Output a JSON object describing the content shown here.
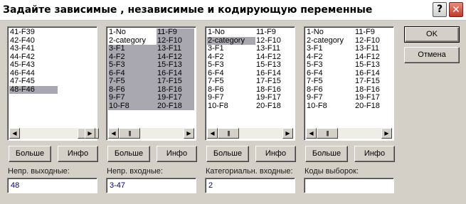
{
  "window": {
    "title": "Задайте зависимые , независимые и кодирующую переменные",
    "help_label": "?",
    "close_label": "✕"
  },
  "lists": [
    {
      "items": [
        {
          "label": "41-F39",
          "selected": false
        },
        {
          "label": "42-F40",
          "selected": false
        },
        {
          "label": "43-F41",
          "selected": false
        },
        {
          "label": "44-F42",
          "selected": false
        },
        {
          "label": "45-F43",
          "selected": false
        },
        {
          "label": "46-F44",
          "selected": false
        },
        {
          "label": "47-F45",
          "selected": false
        },
        {
          "label": "48-F46",
          "selected": true
        }
      ]
    },
    {
      "items": [
        {
          "label": "1-No",
          "selected": false
        },
        {
          "label": "2-category",
          "selected": false
        },
        {
          "label": "3-F1",
          "selected": true
        },
        {
          "label": "4-F2",
          "selected": true
        },
        {
          "label": "5-F3",
          "selected": true
        },
        {
          "label": "6-F4",
          "selected": true
        },
        {
          "label": "7-F5",
          "selected": true
        },
        {
          "label": "8-F6",
          "selected": true
        },
        {
          "label": "9-F7",
          "selected": true
        },
        {
          "label": "10-F8",
          "selected": true
        },
        {
          "label": "11-F9",
          "selected": true
        },
        {
          "label": "12-F10",
          "selected": true
        },
        {
          "label": "13-F11",
          "selected": true
        },
        {
          "label": "14-F12",
          "selected": true
        },
        {
          "label": "15-F13",
          "selected": true
        },
        {
          "label": "16-F14",
          "selected": true
        },
        {
          "label": "17-F15",
          "selected": true
        },
        {
          "label": "18-F16",
          "selected": true
        },
        {
          "label": "19-F17",
          "selected": true
        },
        {
          "label": "20-F18",
          "selected": true
        }
      ]
    },
    {
      "items": [
        {
          "label": "1-No",
          "selected": false
        },
        {
          "label": "2-category",
          "selected": true
        },
        {
          "label": "3-F1",
          "selected": false
        },
        {
          "label": "4-F2",
          "selected": false
        },
        {
          "label": "5-F3",
          "selected": false
        },
        {
          "label": "6-F4",
          "selected": false
        },
        {
          "label": "7-F5",
          "selected": false
        },
        {
          "label": "8-F6",
          "selected": false
        },
        {
          "label": "9-F7",
          "selected": false
        },
        {
          "label": "10-F8",
          "selected": false
        },
        {
          "label": "11-F9",
          "selected": false
        },
        {
          "label": "12-F10",
          "selected": false
        },
        {
          "label": "13-F11",
          "selected": false
        },
        {
          "label": "14-F12",
          "selected": false
        },
        {
          "label": "15-F13",
          "selected": false
        },
        {
          "label": "16-F14",
          "selected": false
        },
        {
          "label": "17-F15",
          "selected": false
        },
        {
          "label": "18-F16",
          "selected": false
        },
        {
          "label": "19-F17",
          "selected": false
        },
        {
          "label": "20-F18",
          "selected": false
        }
      ]
    },
    {
      "items": [
        {
          "label": "1-No",
          "selected": false
        },
        {
          "label": "2-category",
          "selected": false
        },
        {
          "label": "3-F1",
          "selected": false
        },
        {
          "label": "4-F2",
          "selected": false
        },
        {
          "label": "5-F3",
          "selected": false
        },
        {
          "label": "6-F4",
          "selected": false
        },
        {
          "label": "7-F5",
          "selected": false
        },
        {
          "label": "8-F6",
          "selected": false
        },
        {
          "label": "9-F7",
          "selected": false
        },
        {
          "label": "10-F8",
          "selected": false
        },
        {
          "label": "11-F9",
          "selected": false
        },
        {
          "label": "12-F10",
          "selected": false
        },
        {
          "label": "13-F11",
          "selected": false
        },
        {
          "label": "14-F12",
          "selected": false
        },
        {
          "label": "15-F13",
          "selected": false
        },
        {
          "label": "16-F14",
          "selected": false
        },
        {
          "label": "17-F15",
          "selected": false
        },
        {
          "label": "18-F16",
          "selected": false
        },
        {
          "label": "19-F17",
          "selected": false
        },
        {
          "label": "20-F18",
          "selected": false
        }
      ]
    }
  ],
  "buttons": {
    "more_label": "Больше",
    "info_label": "Инфо",
    "ok_label": "OK",
    "cancel_label": "Отмена"
  },
  "fields": [
    {
      "label": "Непр. выходные:",
      "value": "48"
    },
    {
      "label": "Непр. входные:",
      "value": "3-47"
    },
    {
      "label": "Категориальн. входные:",
      "value": "2"
    },
    {
      "label": "Коды выборок:",
      "value": ""
    }
  ],
  "icons": {
    "scroll_left": "◀",
    "scroll_right": "▶",
    "scroll_thumb": "|||"
  },
  "colors": {
    "selection": "#a9a8b0",
    "face": "#d4d0c8",
    "field_text": "#000080"
  }
}
